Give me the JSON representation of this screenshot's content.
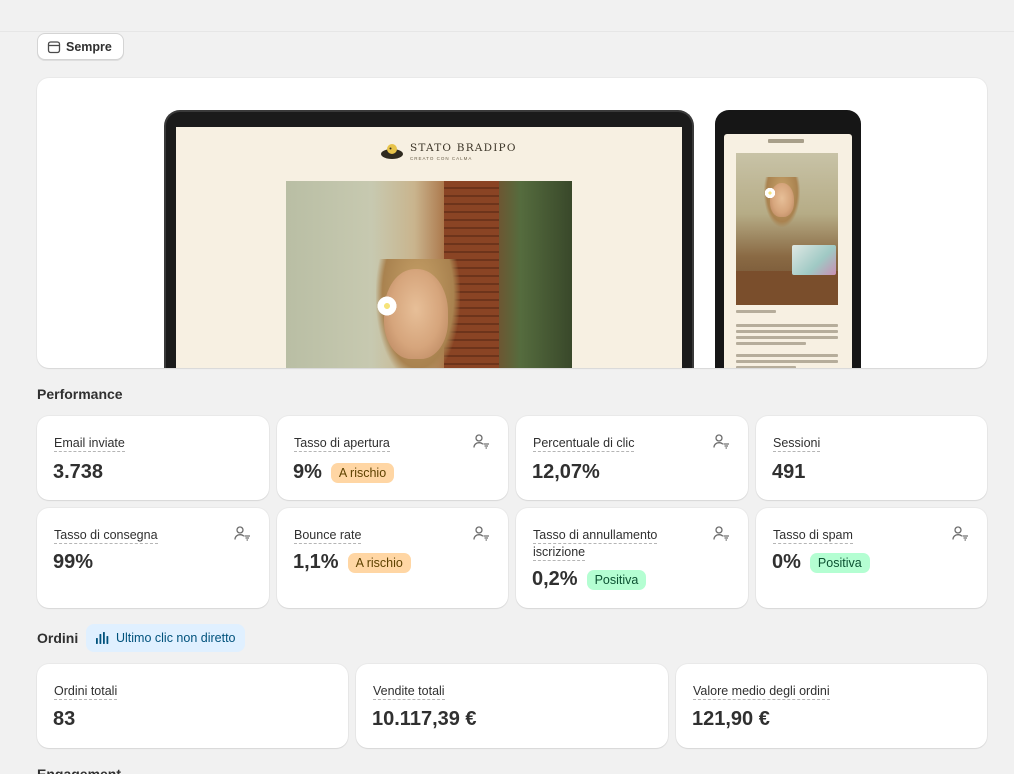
{
  "date_filter": {
    "label": "Sempre",
    "icon": "calendar-icon"
  },
  "preview": {
    "brand_name": "STATO BRADIPO",
    "brand_tagline": "CREATO CON CALMA"
  },
  "performance": {
    "title": "Performance",
    "metrics": [
      {
        "label": "Email inviate",
        "value": "3.738",
        "badge": ""
      },
      {
        "label": "Tasso di apertura",
        "value": "9%",
        "badge": "A rischio",
        "badge_tone": "warn"
      },
      {
        "label": "Percentuale di clic",
        "value": "12,07%",
        "badge": ""
      },
      {
        "label": "Sessioni",
        "value": "491",
        "badge": ""
      },
      {
        "label": "Tasso di consegna",
        "value": "99%",
        "badge": ""
      },
      {
        "label": "Bounce rate",
        "value": "1,1%",
        "badge": "A rischio",
        "badge_tone": "warn"
      },
      {
        "label": "Tasso di annullamento iscrizione",
        "value": "0,2%",
        "badge": "Positiva",
        "badge_tone": "ok"
      },
      {
        "label": "Tasso di spam",
        "value": "0%",
        "badge": "Positiva",
        "badge_tone": "ok"
      }
    ]
  },
  "orders": {
    "title": "Ordini",
    "attribution_label": "Ultimo clic non diretto",
    "metrics": [
      {
        "label": "Ordini totali",
        "value": "83"
      },
      {
        "label": "Vendite totali",
        "value": "10.117,39 €"
      },
      {
        "label": "Valore medio degli ordini",
        "value": "121,90 €"
      }
    ]
  },
  "engagement": {
    "title": "Engagement"
  },
  "colors": {
    "warn_badge_bg": "#ffd6a4",
    "ok_badge_bg": "#b4fed2",
    "attribution_chip_bg": "#e0f0ff"
  }
}
